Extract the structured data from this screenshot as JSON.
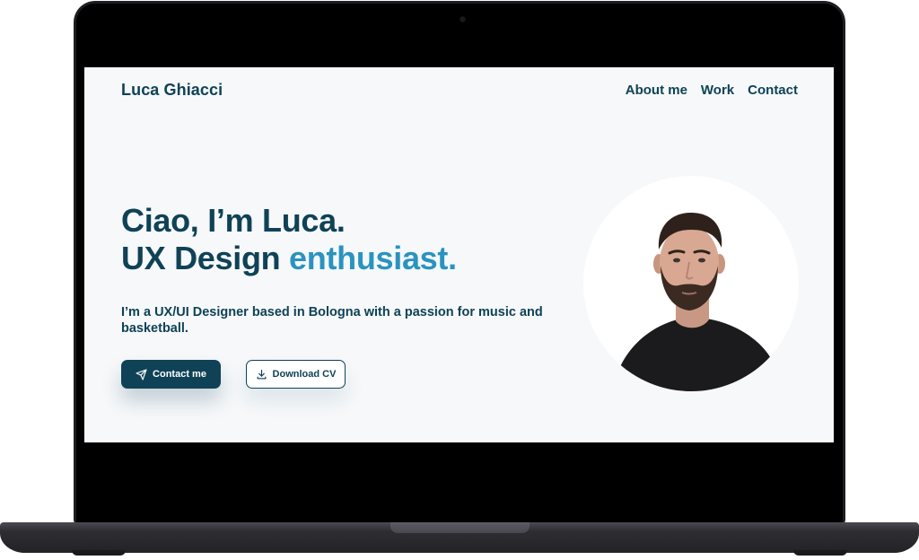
{
  "site": {
    "brand": "Luca Ghiacci",
    "nav": {
      "about": "About me",
      "work": "Work",
      "contact": "Contact"
    }
  },
  "hero": {
    "line1": "Ciao, I’m Luca.",
    "line2_start": "UX Design ",
    "line2_accent": "enthusiast.",
    "subtitle": "I’m a UX/UI Designer based in Bologna with a passion for music and basketball.",
    "primary_button": "Contact me",
    "secondary_button": "Download CV"
  },
  "colors": {
    "primary": "#0f4256",
    "accent": "#2a93bf",
    "background": "#f6f8fa"
  },
  "icons": {
    "primary_button": "send-icon",
    "secondary_button": "download-icon"
  }
}
